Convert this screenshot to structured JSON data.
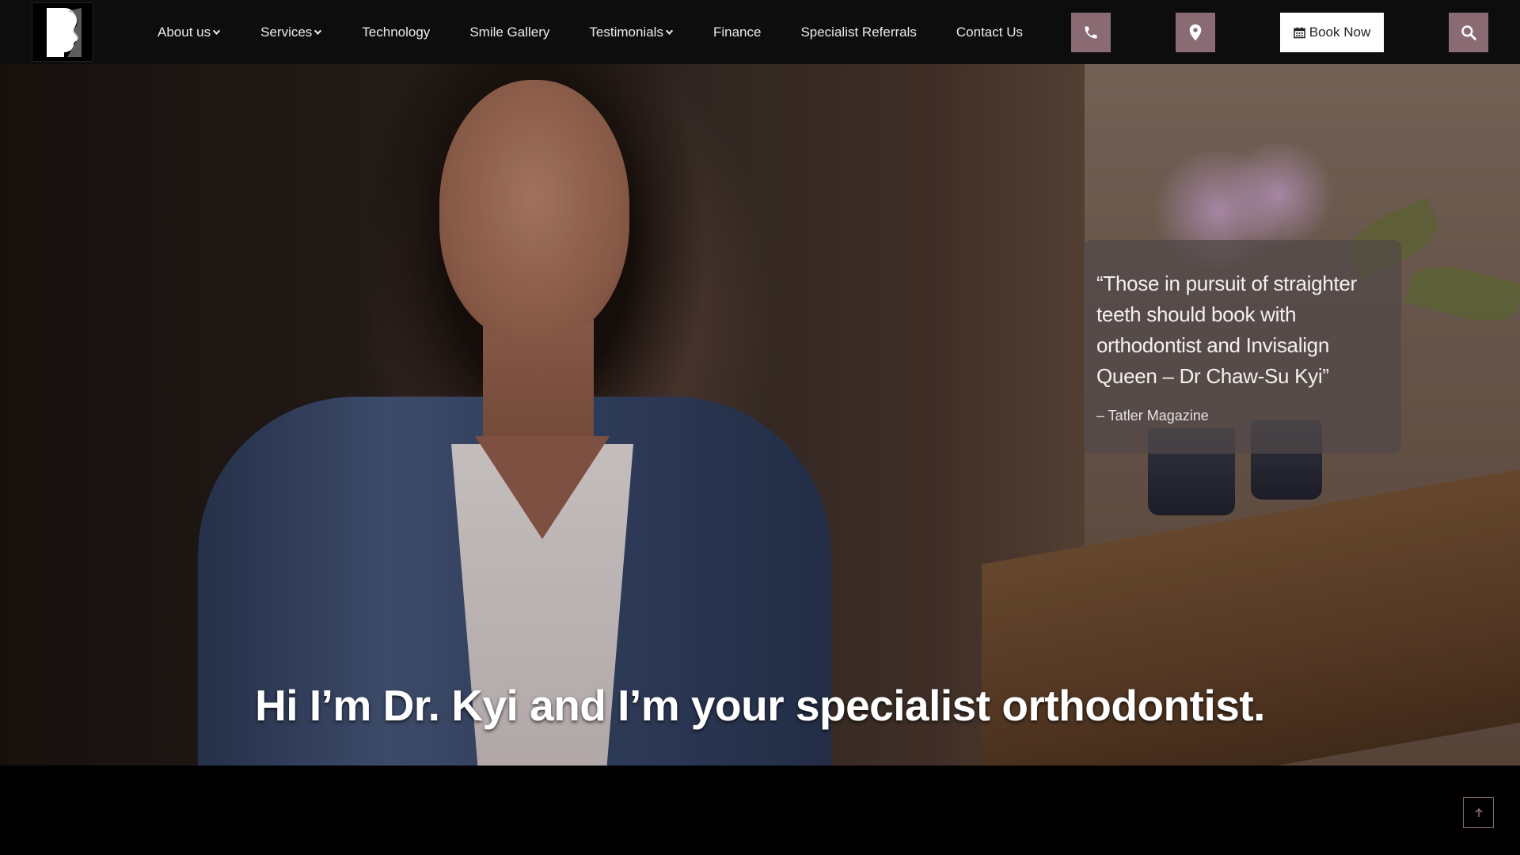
{
  "nav": {
    "items": [
      {
        "label": "About us",
        "dropdown": true
      },
      {
        "label": "Services",
        "dropdown": true
      },
      {
        "label": "Technology",
        "dropdown": false
      },
      {
        "label": "Smile Gallery",
        "dropdown": false
      },
      {
        "label": "Testimonials",
        "dropdown": true
      },
      {
        "label": "Finance",
        "dropdown": false
      },
      {
        "label": "Specialist Referrals",
        "dropdown": false
      },
      {
        "label": "Contact Us",
        "dropdown": false
      }
    ],
    "book_label": "Book Now"
  },
  "icons": {
    "logo": "profile-logo-icon",
    "phone": "phone-icon",
    "location": "map-pin-icon",
    "calendar": "calendar-icon",
    "search": "search-icon",
    "back_to_top": "arrow-up-icon"
  },
  "hero": {
    "quote": "“Those in pursuit of straighter teeth should book with orthodontist and Invisalign Queen – Dr Chaw-Su Kyi”",
    "source": "– Tatler Magazine",
    "caption": "Hi I’m Dr. Kyi and I’m your specialist orthodontist."
  },
  "colors": {
    "header_bg": "#0d0d0d",
    "accent": "#8a6b73",
    "book_bg": "#ffffff"
  }
}
